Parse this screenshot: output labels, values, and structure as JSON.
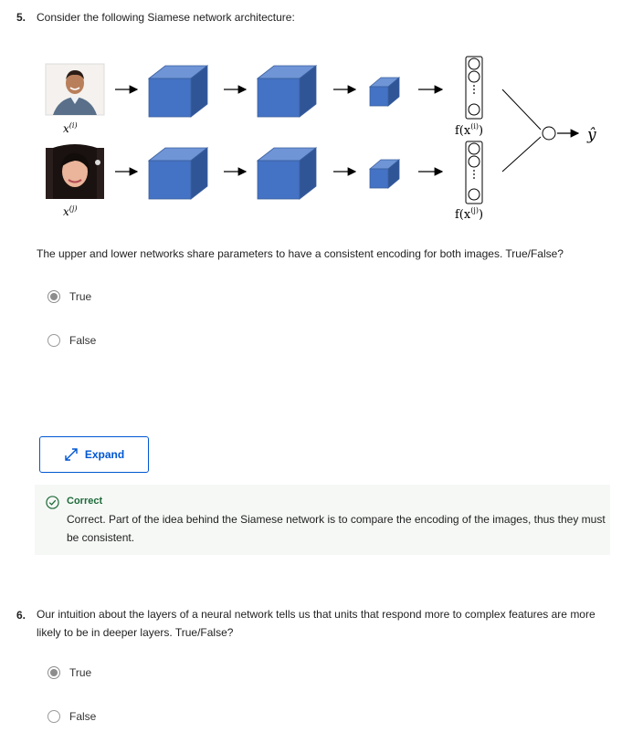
{
  "question5": {
    "number": "5.",
    "prompt": "Consider the following Siamese network architecture:",
    "figure": {
      "input_top_label": "x",
      "input_top_sup": "(i)",
      "input_bottom_label": "x",
      "input_bottom_sup": "(j)",
      "encoding_top_prefix": "f(x",
      "encoding_top_sup": "(i)",
      "encoding_bottom_prefix": "f(x",
      "encoding_bottom_sup": "(j)",
      "encoding_suffix": ")",
      "output_label": "ŷ",
      "cube_color": "#4472c4",
      "cube_top_color": "#6f95d6",
      "cube_side_color": "#2f5597"
    },
    "description": "The upper and lower networks share parameters to have a consistent encoding for both images. True/False?",
    "options": [
      {
        "label": "True",
        "selected": true
      },
      {
        "label": "False",
        "selected": false
      }
    ],
    "expand_label": "Expand",
    "feedback": {
      "title": "Correct",
      "text": "Correct. Part of the idea behind the Siamese network is to compare the encoding of the images, thus they must be consistent.",
      "accent_color": "#1e6a3a"
    }
  },
  "question6": {
    "number": "6.",
    "prompt": "Our intuition about the layers of a neural network tells us that units that respond more to complex features are more likely to be in deeper layers. True/False?",
    "options": [
      {
        "label": "True",
        "selected": true
      },
      {
        "label": "False",
        "selected": false
      }
    ]
  },
  "colors": {
    "link_blue": "#0056d2",
    "correct_green": "#1e6a3a",
    "feedback_bg": "#f5f8f5"
  }
}
